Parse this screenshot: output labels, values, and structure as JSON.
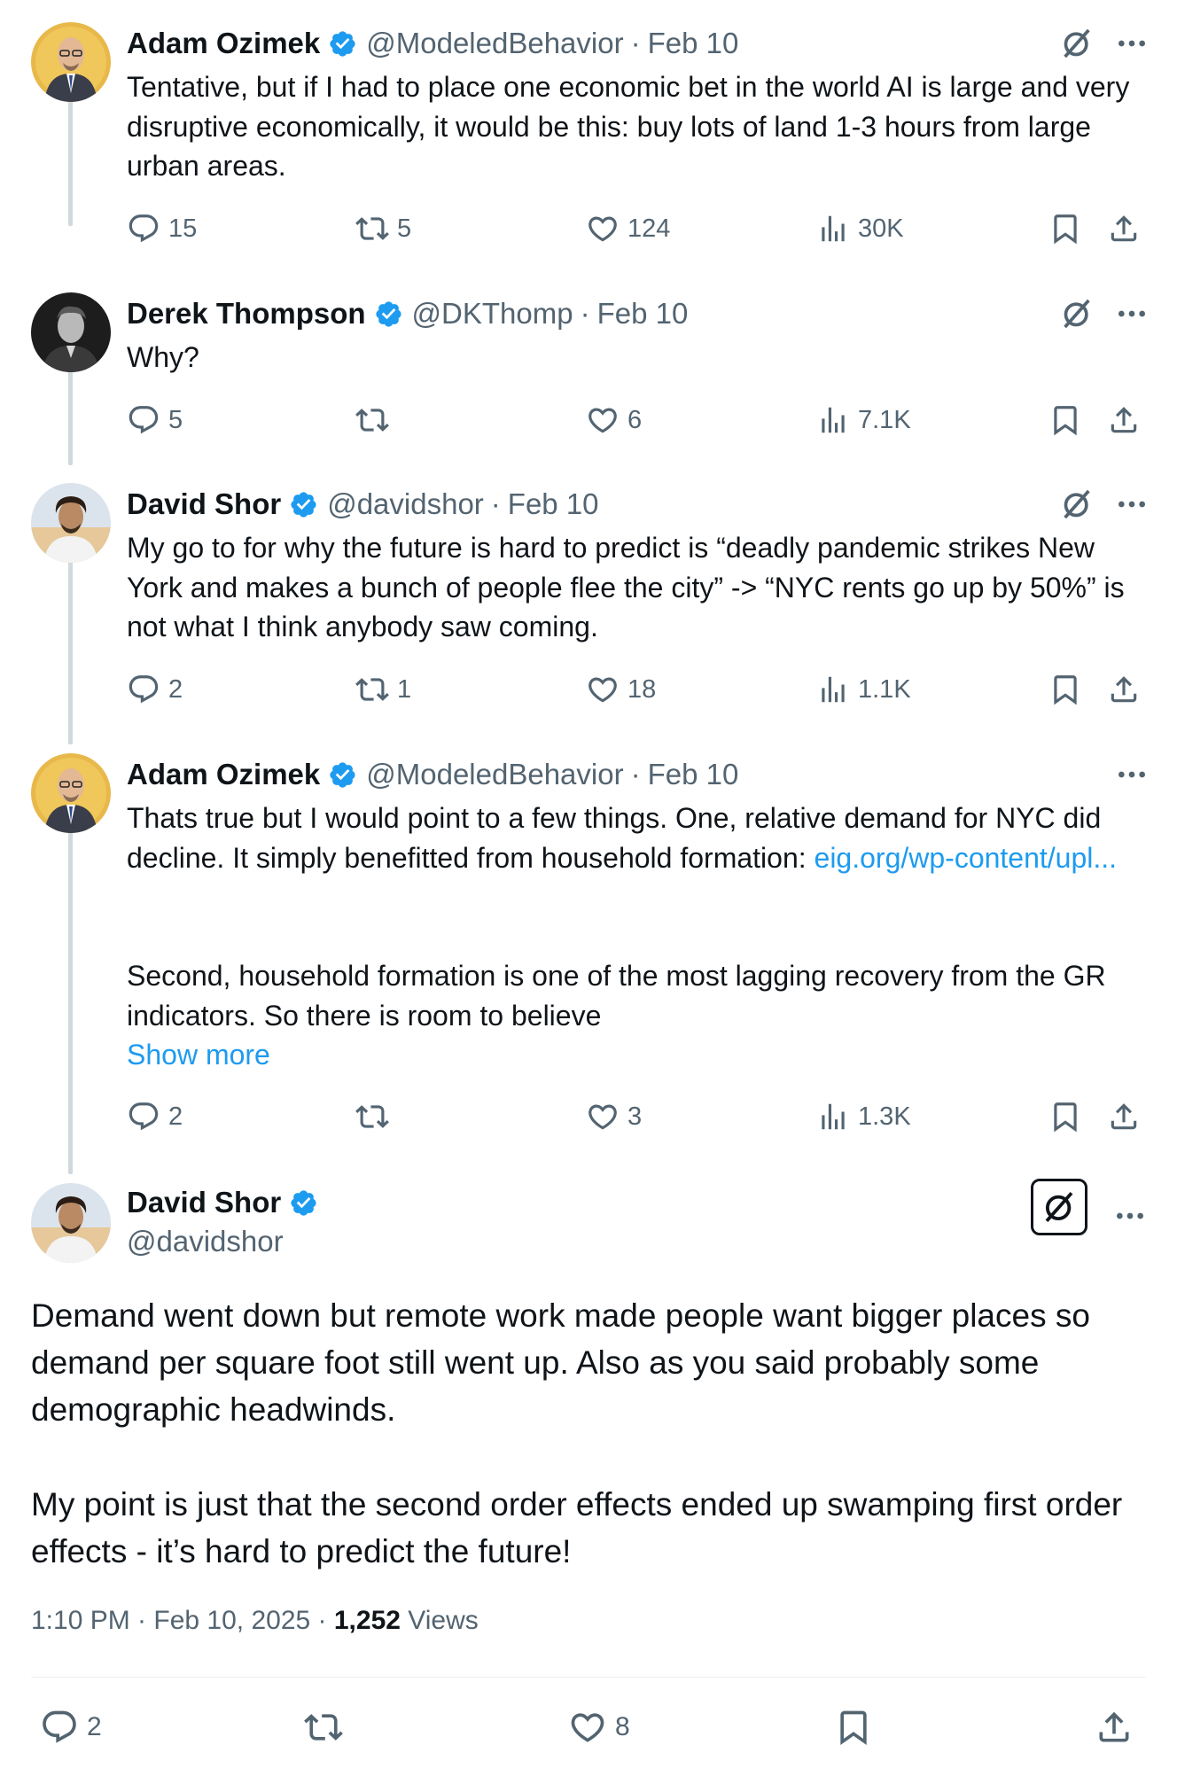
{
  "tweets": [
    {
      "name": "Adam Ozimek",
      "handle": "@ModeledBehavior",
      "date": "Feb 10",
      "text": "Tentative, but if I had to place one economic bet in the world AI is large and very disruptive economically, it would be this: buy lots of land 1-3 hours from large urban areas.",
      "replies": "15",
      "reposts": "5",
      "likes": "124",
      "views": "30K"
    },
    {
      "name": "Derek Thompson",
      "handle": "@DKThomp",
      "date": "Feb 10",
      "text": "Why?",
      "replies": "5",
      "reposts": "",
      "likes": "6",
      "views": "7.1K"
    },
    {
      "name": "David Shor",
      "handle": "@davidshor",
      "date": "Feb 10",
      "text": "My go to for why the future is hard to predict is “deadly pandemic strikes New York and makes a bunch of people flee the city” -> “NYC rents go up by 50%” is not what I think anybody saw coming.",
      "replies": "2",
      "reposts": "1",
      "likes": "18",
      "views": "1.1K"
    },
    {
      "name": "Adam Ozimek",
      "handle": "@ModeledBehavior",
      "date": "Feb 10",
      "text_a": "Thats true but I would point to a few things. One, relative demand for NYC did decline. It simply benefitted from household formation: ",
      "link": "eig.org/wp-content/upl...",
      "text_b": "Second, household formation is one of the most lagging recovery from the GR indicators. So there is room to believe",
      "show_more": "Show more",
      "replies": "2",
      "reposts": "",
      "likes": "3",
      "views": "1.3K"
    }
  ],
  "main": {
    "name": "David Shor",
    "handle": "@davidshor",
    "text_1": "Demand went down but remote work made people want bigger places so demand per square foot still went up. Also as you said probably some demographic headwinds.",
    "text_2": "My point is just that the second order effects ended up swamping first order effects - it’s hard to predict the future!",
    "time": "1:10 PM · Feb 10, 2025 · ",
    "views_count": "1,252",
    "views_label": " Views",
    "replies": "2",
    "reposts": "",
    "likes": "8"
  },
  "colors": {
    "accent": "#1d9bf0",
    "secondary_text": "#536471",
    "thread_line": "#cfd9de"
  },
  "icons": [
    "verified-badge-icon",
    "grok-icon",
    "more-icon",
    "reply-icon",
    "repost-icon",
    "like-icon",
    "views-icon",
    "bookmark-icon",
    "share-icon"
  ]
}
